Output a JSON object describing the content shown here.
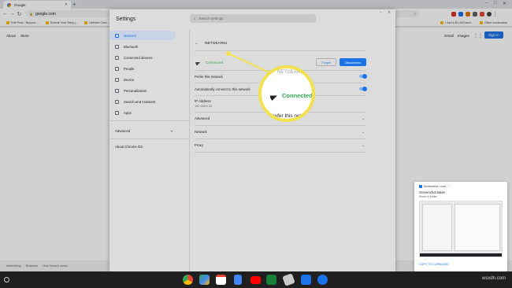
{
  "browser": {
    "tab_title": "Google",
    "url": "google.com",
    "bookmarks": [
      "Edit Post ‹ Beyone ...",
      "Submit Your Story |...",
      "Lifewire Cont..."
    ],
    "bookmarks_right": [
      "I had a $1,440 laun...",
      "Other bookmarks"
    ]
  },
  "google": {
    "top_left": [
      "About",
      "Store"
    ],
    "top_right": [
      "Gmail",
      "Images"
    ],
    "sign_in": "Sign in",
    "footer_left": [
      "Advertising",
      "Business",
      "How Search works"
    ]
  },
  "settings": {
    "title": "Settings",
    "search_placeholder": "Search settings",
    "sidebar": [
      "Network",
      "Bluetooth",
      "Connected devices",
      "People",
      "Device",
      "Personalization",
      "Search and Assistant",
      "Apps"
    ],
    "advanced": "Advanced",
    "about": "About Chrome OS",
    "network_name": "NETGEAR61",
    "status": "Connected",
    "forget": "Forget",
    "disconnect": "Disconnect",
    "prefer": "Prefer this network",
    "auto_connect": "Automatically connect to this network",
    "ip_label": "IP Address",
    "ip_value": "192.168.0.24",
    "sections": [
      "Advanced",
      "Network",
      "Proxy"
    ]
  },
  "magnifier": {
    "status": "Connected",
    "prefer_text": "Prefer this network"
  },
  "notification": {
    "source": "Screenshot • now",
    "title": "Screenshot taken",
    "subtitle": "Show in folder",
    "action": "COPY TO CLIPBOARD"
  },
  "watermark": "wsxdn.com",
  "colors": {
    "accent": "#1a73e8",
    "connected": "#34a853",
    "callout": "#f3e24f"
  }
}
